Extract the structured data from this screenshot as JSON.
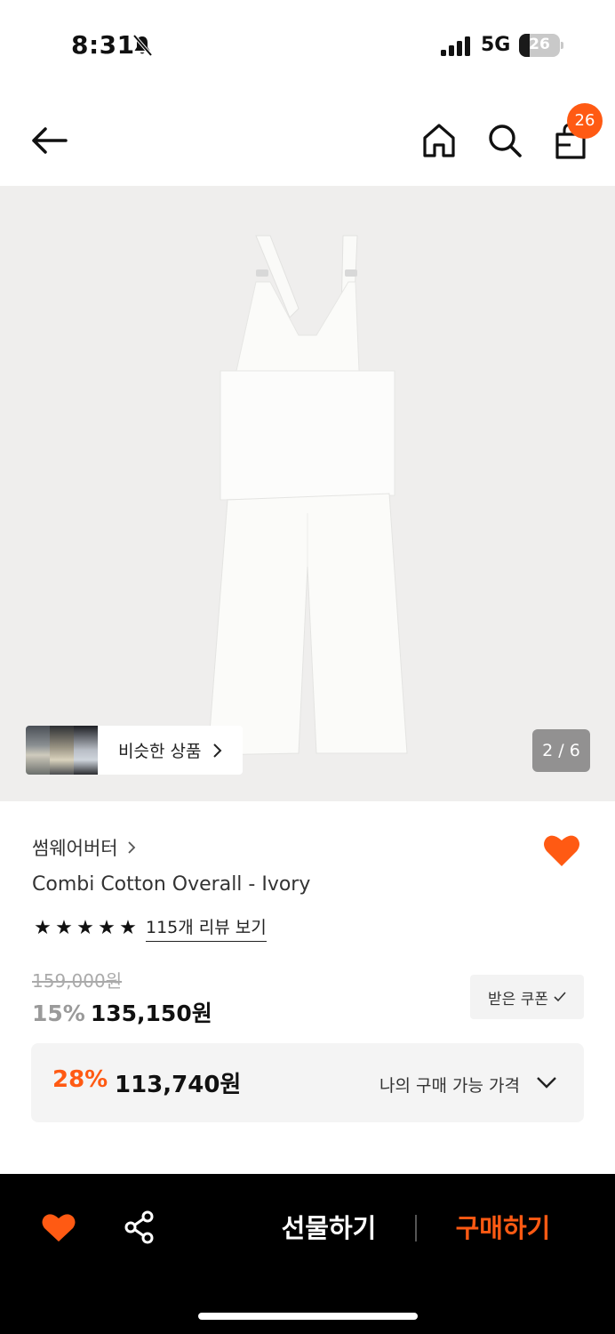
{
  "status_bar": {
    "time": "8:31",
    "network": "5G",
    "battery": "26",
    "battery_level_percent": 26,
    "icons": [
      "bell-slash-icon",
      "signal-icon",
      "battery-icon"
    ]
  },
  "header": {
    "icons": [
      "back-arrow-icon",
      "home-icon",
      "search-icon",
      "cart-icon"
    ],
    "cart_count": "26"
  },
  "gallery": {
    "similar_label": "비슷한 상품",
    "page_indicator": "2 / 6",
    "background": "#efeeed"
  },
  "product": {
    "brand": "썸웨어버터",
    "title": "Combi Cotton Overall - Ivory",
    "rating_stars": 5,
    "review_link": "115개 리뷰 보기",
    "original_price": "159,000원",
    "sale_rate": "15%",
    "sale_price": "135,150원",
    "coupon_label": "받은 쿠폰",
    "wishlisted": true
  },
  "my_price": {
    "rate": "28%",
    "price": "113,740원",
    "label": "나의 구매 가능 가격"
  },
  "bottom_bar": {
    "gift_label": "선물하기",
    "buy_label": "구매하기"
  },
  "colors": {
    "accent": "#ff5a13",
    "text": "#111111",
    "bottom_bar": "#000000"
  }
}
